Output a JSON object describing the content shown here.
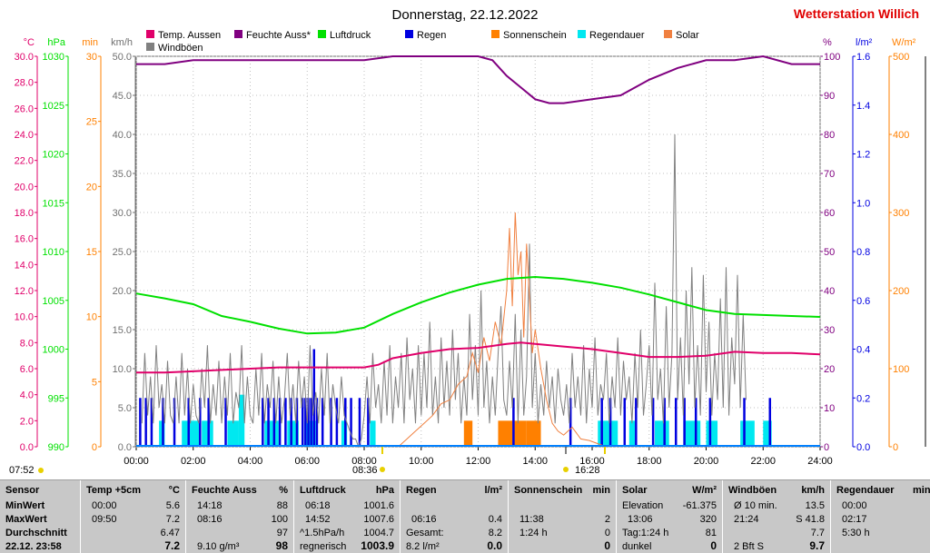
{
  "header": {
    "title": "Donnerstag, 22.12.2022",
    "station": "Wetterstation Willich"
  },
  "colors": {
    "temp": "#e0006a",
    "humidity": "#800080",
    "pressure": "#00e000",
    "rain": "#0000e0",
    "sunshine": "#ff8000",
    "raindur": "#00e8f0",
    "solar": "#f08040",
    "gust": "#808080",
    "wind": "#0080ff"
  },
  "legend": [
    {
      "label": "Temp. Aussen",
      "color": "#e0006a"
    },
    {
      "label": "Feuchte Auss*",
      "color": "#800080"
    },
    {
      "label": "Luftdruck",
      "color": "#00e000"
    },
    {
      "label": "Regen",
      "color": "#0000e0"
    },
    {
      "label": "Sonnenschein",
      "color": "#ff8000"
    },
    {
      "label": "Regendauer",
      "color": "#00e8f0"
    },
    {
      "label": "Solar",
      "color": "#f08040"
    },
    {
      "label": "Windböen",
      "color": "#808080"
    }
  ],
  "markers": {
    "sunrise": "07:52",
    "midday_a": "08:36",
    "midday_b": "16:28"
  },
  "chart_data": {
    "type": "line",
    "x_unit": "hour",
    "x_ticks": [
      "00:00",
      "02:00",
      "04:00",
      "06:00",
      "08:00",
      "10:00",
      "12:00",
      "14:00",
      "16:00",
      "18:00",
      "20:00",
      "22:00",
      "24:00"
    ],
    "axes": {
      "temp": {
        "unit": "°C",
        "range": [
          0,
          30
        ],
        "ticks": [
          "0.0",
          "2.0",
          "4.0",
          "6.0",
          "8.0",
          "10.0",
          "12.0",
          "14.0",
          "16.0",
          "18.0",
          "20.0",
          "22.0",
          "24.0",
          "26.0",
          "28.0",
          "30.0"
        ]
      },
      "hpa": {
        "unit": "hPa",
        "range": [
          990,
          1030
        ],
        "ticks": [
          "990",
          "995",
          "1000",
          "1005",
          "1010",
          "1015",
          "1020",
          "1025",
          "1030"
        ]
      },
      "min": {
        "unit": "min",
        "range": [
          0,
          30
        ],
        "ticks": [
          "0",
          "5",
          "10",
          "15",
          "20",
          "25",
          "30"
        ]
      },
      "kmh": {
        "unit": "km/h",
        "range": [
          0,
          50
        ],
        "ticks": [
          "0.0",
          "5.0",
          "10.0",
          "15.0",
          "20.0",
          "25.0",
          "30.0",
          "35.0",
          "40.0",
          "45.0",
          "50.0"
        ]
      },
      "pct": {
        "unit": "%",
        "range": [
          0,
          100
        ],
        "ticks": [
          "0",
          "10",
          "20",
          "30",
          "40",
          "50",
          "60",
          "70",
          "80",
          "90",
          "100"
        ]
      },
      "lm2": {
        "unit": "l/m²",
        "range": [
          0,
          1.6
        ],
        "ticks": [
          "0.0",
          "0.2",
          "0.4",
          "0.6",
          "0.8",
          "1.0",
          "1.2",
          "1.4",
          "1.6"
        ]
      },
      "wm2": {
        "unit": "W/m²",
        "range": [
          0,
          500
        ],
        "ticks": [
          "0",
          "100",
          "200",
          "300",
          "400",
          "500"
        ]
      }
    },
    "series": [
      {
        "name": "Temp. Aussen",
        "axis": "temp",
        "x": [
          0,
          1,
          2,
          3,
          4,
          5,
          6,
          7,
          8,
          8.5,
          9,
          10,
          11,
          12,
          13,
          13.5,
          14,
          15,
          16,
          17,
          18,
          19,
          20,
          21,
          22,
          23,
          24
        ],
        "values": [
          5.7,
          5.7,
          5.8,
          5.9,
          6.0,
          6.1,
          6.1,
          6.1,
          6.1,
          6.3,
          6.8,
          7.2,
          7.5,
          7.6,
          7.9,
          8.0,
          7.9,
          7.7,
          7.5,
          7.2,
          6.9,
          6.9,
          7.0,
          7.3,
          7.2,
          7.2,
          7.1
        ]
      },
      {
        "name": "Feuchte Auss*",
        "axis": "pct",
        "x": [
          0,
          1,
          2,
          4,
          6,
          8,
          9,
          10,
          11,
          12,
          12.5,
          13,
          13.5,
          14,
          14.5,
          15,
          16,
          17,
          18,
          19,
          20,
          21,
          22,
          23,
          24
        ],
        "values": [
          98,
          98,
          99,
          99,
          99,
          99,
          100,
          100,
          100,
          100,
          99,
          95,
          92,
          89,
          88,
          88,
          89,
          90,
          94,
          97,
          99,
          99,
          100,
          98,
          98
        ]
      },
      {
        "name": "Luftdruck",
        "axis": "hpa",
        "x": [
          0,
          1,
          2,
          3,
          4,
          5,
          6,
          7,
          8,
          9,
          10,
          11,
          12,
          13,
          14,
          15,
          16,
          17,
          18,
          19,
          20,
          21,
          22,
          23,
          24
        ],
        "values": [
          1005.7,
          1005.2,
          1004.6,
          1003.4,
          1002.8,
          1002.1,
          1001.6,
          1001.7,
          1002.2,
          1003.6,
          1004.8,
          1005.8,
          1006.6,
          1007.2,
          1007.4,
          1007.2,
          1006.8,
          1006.3,
          1005.6,
          1004.8,
          1004.0,
          1003.6,
          1003.5,
          1003.4,
          1003.3
        ]
      }
    ],
    "gust_series": {
      "name": "Windböen",
      "axis": "kmh",
      "x_start": 0.2,
      "x_step": 0.1,
      "values": [
        3,
        12,
        4,
        9,
        3,
        13,
        5,
        8,
        3,
        11,
        4,
        3,
        9,
        3,
        12,
        4,
        10,
        3,
        8,
        4,
        3,
        10,
        5,
        13,
        3,
        8,
        4,
        11,
        3,
        9,
        4,
        12,
        3,
        7,
        5,
        13,
        3,
        9,
        4,
        3,
        10,
        4,
        12,
        3,
        8,
        5,
        11,
        3,
        9,
        3,
        6,
        12,
        4,
        8,
        3,
        11,
        5,
        9,
        3,
        13,
        4,
        7,
        3,
        10,
        4,
        12,
        3,
        8,
        5,
        3,
        9,
        4,
        3,
        2,
        1,
        1,
        0,
        1,
        4,
        9,
        3,
        12,
        5,
        8,
        3,
        11,
        4,
        13,
        3,
        9,
        5,
        12,
        3,
        14,
        6,
        10,
        3,
        13,
        4,
        12,
        5,
        16,
        4,
        9,
        3,
        14,
        5,
        11,
        4,
        15,
        6,
        12,
        3,
        9,
        4,
        17,
        6,
        13,
        4,
        20,
        5,
        11,
        3,
        9,
        4,
        12,
        18,
        6,
        4,
        11,
        5,
        17,
        3,
        15,
        4,
        9,
        26,
        5,
        12,
        3,
        8,
        4,
        11,
        5,
        9,
        3,
        10,
        6,
        4,
        8,
        3,
        12,
        5,
        9,
        4,
        13,
        3,
        10,
        5,
        14,
        4,
        8,
        6,
        12,
        3,
        9,
        5,
        14,
        4,
        11,
        6,
        9,
        3,
        12,
        5,
        15,
        4,
        8,
        13,
        4,
        21,
        6,
        10,
        3,
        18,
        5,
        12,
        40,
        6,
        14,
        4,
        20,
        8,
        23,
        5,
        13,
        4,
        22,
        7,
        16,
        4,
        12,
        6,
        19,
        5,
        23,
        4,
        14,
        8,
        22,
        5,
        17,
        6
      ]
    },
    "rain_bars": {
      "name": "Regen",
      "axis": "lm2",
      "x": [
        0.1,
        0.3,
        0.5,
        0.9,
        1.3,
        1.8,
        2.2,
        2.5,
        3.1,
        4.4,
        4.6,
        4.8,
        5.0,
        5.2,
        5.4,
        5.6,
        5.8,
        5.9,
        6.0,
        6.1,
        6.2,
        6.3,
        6.5,
        6.8,
        7.0,
        7.3,
        7.5,
        7.8,
        8.1,
        13.2,
        15.2,
        16.3,
        16.6,
        17.1,
        17.5,
        18.1,
        18.5,
        18.9,
        19.2,
        19.6,
        20.1,
        21.3,
        22.2
      ],
      "values": [
        0.2,
        0.2,
        0.2,
        0.2,
        0.2,
        0.2,
        0.2,
        0.2,
        0.2,
        0.2,
        0.2,
        0.2,
        0.2,
        0.2,
        0.2,
        0.2,
        0.2,
        0.2,
        0.2,
        0.2,
        0.4,
        0.2,
        0.2,
        0.2,
        0.2,
        0.2,
        0.2,
        0.2,
        0.2,
        0.2,
        0.2,
        0.2,
        0.2,
        0.2,
        0.2,
        0.2,
        0.2,
        0.2,
        0.2,
        0.2,
        0.2,
        0.2,
        0.2
      ]
    },
    "sunshine_bars": {
      "name": "Sonnenschein",
      "axis": "min",
      "x": [
        11.5,
        12.7,
        13.2,
        13.7
      ],
      "width": [
        0.3,
        0.5,
        0.5,
        0.5
      ],
      "values": [
        2,
        2,
        2,
        2
      ]
    },
    "raindur_bars": {
      "name": "Regendauer",
      "axis": "min",
      "x": [
        0.8,
        1.6,
        2.3,
        3.2,
        3.6,
        4.5,
        5.3,
        5.9,
        7.2,
        8.2,
        16.2,
        16.7,
        17.3,
        18.2,
        19.2,
        20.0,
        21.2,
        22.0
      ],
      "width": [
        0.2,
        0.6,
        0.4,
        0.4,
        0.2,
        0.5,
        0.4,
        0.4,
        0.2,
        0.2,
        0.5,
        0.2,
        0.2,
        0.5,
        0.6,
        0.4,
        0.5,
        0.3
      ],
      "values": [
        2,
        2,
        2,
        2,
        4,
        2,
        2,
        2,
        2,
        2,
        2,
        2,
        2,
        2,
        2,
        2,
        2,
        2
      ]
    },
    "solar_series": {
      "name": "Solar",
      "axis": "wm2",
      "x": [
        9.2,
        9.5,
        9.8,
        10.1,
        10.4,
        10.7,
        11.0,
        11.3,
        11.6,
        11.8,
        12.0,
        12.2,
        12.4,
        12.6,
        12.8,
        13.0,
        13.1,
        13.2,
        13.3,
        13.4,
        13.5,
        13.6,
        13.7,
        13.8,
        13.9,
        14.0,
        14.2,
        14.4,
        14.6,
        14.8,
        15.0,
        15.3,
        15.6,
        15.9,
        16.2,
        16.5
      ],
      "values": [
        0,
        10,
        20,
        30,
        40,
        55,
        60,
        80,
        90,
        120,
        95,
        140,
        110,
        160,
        130,
        200,
        280,
        180,
        300,
        220,
        250,
        140,
        260,
        190,
        120,
        150,
        100,
        60,
        30,
        20,
        15,
        25,
        10,
        8,
        4,
        0
      ]
    }
  },
  "table": {
    "headers": {
      "sensor": "Sensor",
      "temp": "Temp +5cm",
      "temp_unit": "°C",
      "feuchte": "Feuchte Auss",
      "feuchte_unit": "%",
      "luft": "Luftdruck",
      "luft_unit": "hPa",
      "regen": "Regen",
      "regen_unit": "l/m²",
      "sonne": "Sonnenschein",
      "sonne_unit": "min",
      "solar": "Solar",
      "solar_unit": "W/m²",
      "wind": "Windböen",
      "wind_unit": "km/h",
      "rdauer": "Regendauer",
      "rdauer_unit": "min"
    },
    "rows": {
      "min": "MinWert",
      "max": "MaxWert",
      "avg": "Durchschnitt",
      "now": "22.12. 23:58"
    },
    "temp": {
      "min_t": "00:00",
      "min_v": "5.6",
      "max_t": "09:50",
      "max_v": "7.2",
      "avg_v": "6.47",
      "now_v": "7.2"
    },
    "feuchte": {
      "min_t": "14:18",
      "min_v": "88",
      "max_t": "08:16",
      "max_v": "100",
      "avg_v": "97",
      "now_extra": "9.10 g/m³",
      "now_v": "98"
    },
    "luft": {
      "min_t": "06:18",
      "min_v": "1001.6",
      "max_t": "14:52",
      "max_v": "1007.6",
      "avg_l": "^1.5hPa/h",
      "avg_v": "1004.7",
      "now_l": "regnerisch",
      "now_v": "1003.9"
    },
    "regen": {
      "r2_t": "06:16",
      "r2_v": "0.4",
      "r3_l": "Gesamt:",
      "r3_v": "8.2",
      "now_l": "8.2 l/m²",
      "now_v": "0.0"
    },
    "sonne": {
      "r2_t": "11:38",
      "r2_v": "2",
      "r3_t": "1:24 h",
      "r3_v": "0",
      "now_v": "0"
    },
    "solar": {
      "r1_l": "Elevation",
      "r1_v": "-61.375",
      "r2_t": "13:06",
      "r2_v": "320",
      "r3_l": "Tag:1:24 h",
      "r3_v": "81",
      "now_l": "dunkel",
      "now_v": "0"
    },
    "wind": {
      "r1_l": "Ø 10 min.",
      "r1_v": "13.5",
      "r2_t": "21:24",
      "r2_v": "S 41.8",
      "r3_v": "7.7",
      "now_l": "2 Bft S",
      "now_v": "9.7"
    },
    "rdauer": {
      "r1_t": "00:00",
      "r2_t": "02:17",
      "r3_t": "5:30 h"
    }
  }
}
